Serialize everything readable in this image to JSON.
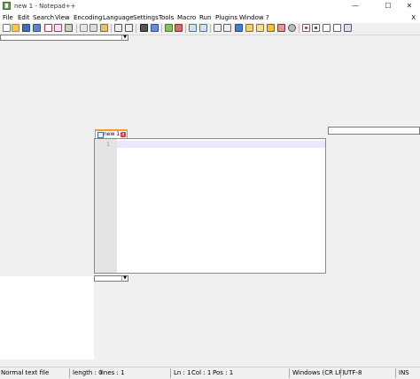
{
  "window": {
    "title": "new 1 - Notepad++",
    "minimize": "—",
    "maximize": "☐",
    "close": "✕"
  },
  "menu": {
    "items": [
      "File",
      "Edit",
      "Search",
      "View",
      "Encoding",
      "Language",
      "Settings",
      "Tools",
      "Macro",
      "Run",
      "Plugins",
      "Window",
      "?"
    ],
    "close_label": "X"
  },
  "toolbar": {
    "icons": [
      "new-file-icon",
      "open-file-icon",
      "save-icon",
      "save-all-icon",
      "close-icon",
      "close-all-icon",
      "print-icon",
      "cut-icon",
      "copy-icon",
      "paste-icon",
      "undo-icon",
      "redo-icon",
      "find-icon",
      "replace-icon",
      "zoom-in-icon",
      "zoom-out-icon",
      "sync-vertical-icon",
      "sync-horizontal-icon",
      "word-wrap-icon",
      "show-all-chars-icon",
      "indent-guide-icon",
      "doc-map-icon",
      "function-list-icon",
      "folder-workspace-icon",
      "monitoring-icon",
      "record-macro-icon",
      "stop-record-icon",
      "play-macro-icon",
      "run-macro-multiple-icon",
      "save-macro-icon"
    ]
  },
  "editor": {
    "tab_label": "new 1",
    "tab_close": "x",
    "line_number": "1"
  },
  "statusbar": {
    "file_type": "Normal text file",
    "length": "length : 0",
    "lines": "lines : 1",
    "ln": "Ln : 1",
    "col": "Col : 1",
    "pos": "Pos : 1",
    "eol": "Windows (CR LF)",
    "encoding": "UTF-8",
    "mode": "INS"
  },
  "colors": {
    "tab_accent": "#f39c2d",
    "current_line": "#e8e8ff",
    "gutter": "#e4e4e4"
  }
}
